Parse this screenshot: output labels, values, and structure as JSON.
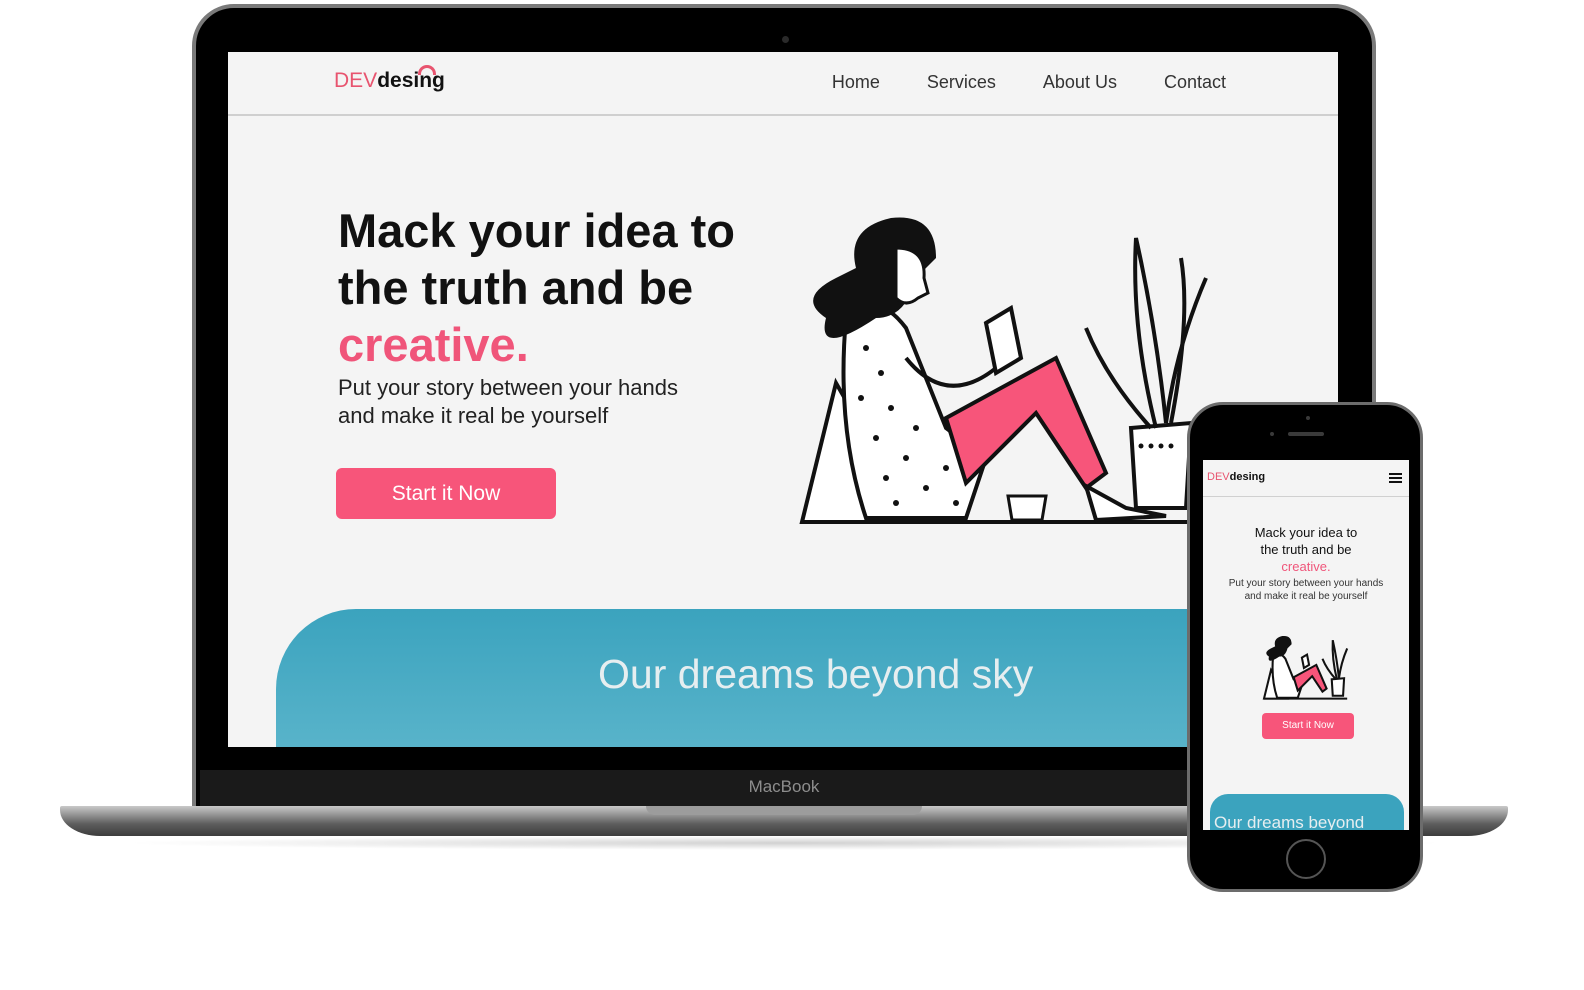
{
  "laptop": {
    "brand_label": "MacBook"
  },
  "site": {
    "logo": {
      "part1": "DEV",
      "part2": "desing"
    },
    "nav": [
      "Home",
      "Services",
      "About Us",
      "Contact"
    ],
    "hero": {
      "title_line1": "Mack your idea to",
      "title_line2": "the truth and be",
      "title_highlight": "creative.",
      "text": "Put your story between your hands and make it real be yourself",
      "button": "Start it Now"
    },
    "band_title": "Our dreams beyond sky"
  },
  "phone_site": {
    "logo": {
      "part1": "DEV",
      "part2": "desing"
    },
    "hero": {
      "title_line1": "Mack your idea to",
      "title_line2": "the truth and be",
      "title_highlight": "creative.",
      "text": "Put your story between your hands and make it real be yourself",
      "button": "Start it Now"
    },
    "band_title": "Our dreams beyond"
  },
  "colors": {
    "accent_pink": "#f7557a",
    "band_blue": "#3ba3be"
  },
  "icons": [
    "hamburger-menu-icon",
    "logo-arc-icon"
  ]
}
